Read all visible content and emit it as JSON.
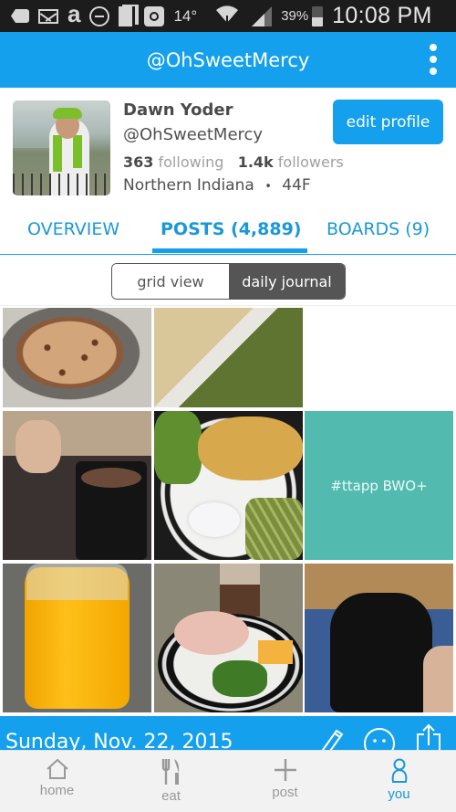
{
  "status_bar": {
    "icons": [
      "add-notification-icon",
      "mail-icon",
      "amazon-icon",
      "do-not-disturb-icon",
      "clipboard-icon",
      "instagram-icon"
    ],
    "temperature": "14°",
    "battery_percent": "39%",
    "battery_level": 0.39,
    "time": "10:08 PM"
  },
  "app_bar": {
    "title": "@OhSweetMercy",
    "menu_icon": "more-vert-icon"
  },
  "profile": {
    "name": "Dawn Yoder",
    "handle": "@OhSweetMercy",
    "following_count": "363",
    "following_label": "following",
    "followers_count": "1.4k",
    "followers_label": "followers",
    "location": "Northern Indiana",
    "separator": "•",
    "age_gender": "44F",
    "edit_button": "edit profile"
  },
  "tabs": [
    {
      "label": "OVERVIEW",
      "active": false
    },
    {
      "label": "POSTS (4,889)",
      "active": true
    },
    {
      "label": "BOARDS (9)",
      "active": false
    }
  ],
  "view_toggle": {
    "options": [
      "grid view",
      "daily journal"
    ],
    "selected": "daily journal"
  },
  "grid": {
    "tiles": [
      {
        "type": "photo",
        "description": "pudding with chocolate shavings"
      },
      {
        "type": "photo",
        "description": "casserole with green beans"
      },
      {
        "type": "empty"
      },
      {
        "type": "photo",
        "description": "boy with mug of cocoa"
      },
      {
        "type": "photo",
        "description": "pancake plate with broccoli and green beans"
      },
      {
        "type": "text",
        "text": "#ttapp BWO+"
      },
      {
        "type": "photo",
        "description": "jar of orange juice"
      },
      {
        "type": "photo",
        "description": "plate with ham, cheese and broccoli"
      },
      {
        "type": "photo",
        "description": "black mug of coffee on book"
      }
    ]
  },
  "journal": {
    "date": "Sunday, Nov. 22, 2015",
    "actions": [
      "edit-pencil-icon",
      "mood-smile-icon",
      "share-icon"
    ]
  },
  "bottom_nav": [
    {
      "label": "home",
      "icon": "home-icon",
      "active": false
    },
    {
      "label": "eat",
      "icon": "fork-knife-icon",
      "active": false
    },
    {
      "label": "post",
      "icon": "plus-icon",
      "active": false
    },
    {
      "label": "you",
      "icon": "person-icon",
      "active": true
    }
  ],
  "colors": {
    "brand_blue": "#14a0ec",
    "tab_text": "#1a98d8",
    "teal_tile": "#53bab0",
    "toggle_active": "#555555",
    "nav_inactive": "#999999"
  }
}
